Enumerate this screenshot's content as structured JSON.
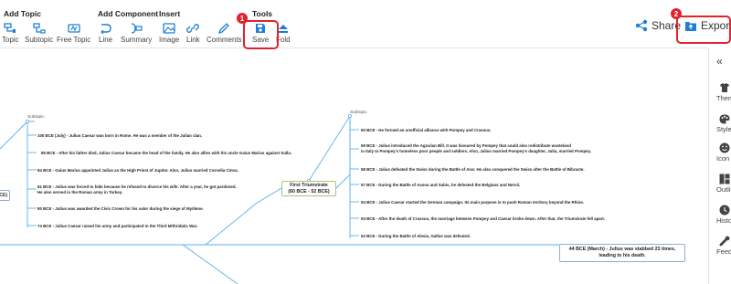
{
  "toolbar": {
    "groups": {
      "add_topic": "Add Topic",
      "add_component": "Add Component",
      "insert": "Insert",
      "tools": "Tools"
    },
    "buttons": {
      "topic": "Topic",
      "subtopic": "Subtopic",
      "free_topic": "Free Topic",
      "line": "Line",
      "summary": "Summary",
      "image": "Image",
      "link": "Link",
      "comments": "Comments",
      "save": "Save",
      "fold": "Fold"
    },
    "share": "Share",
    "export": "Export",
    "badges": {
      "save": "1",
      "export": "2"
    },
    "highlight_color": "#e0232e",
    "icon_color": "#1f7fd6"
  },
  "sidebar": {
    "collapse_icon": "double-chevron-left-icon",
    "items": [
      {
        "label": "Theme",
        "icon": "tshirt-icon"
      },
      {
        "label": "Style",
        "icon": "palette-icon"
      },
      {
        "label": "Icon",
        "icon": "smiley-icon"
      },
      {
        "label": "Outline",
        "icon": "outline-icon"
      },
      {
        "label": "History",
        "icon": "clock-icon"
      },
      {
        "label": "Feedback",
        "icon": "wrench-icon"
      }
    ]
  },
  "mindmap": {
    "line_color": "#5ab0e8",
    "central_topic": {
      "line1": "First Triumvirate",
      "line2": "(60 BCE - 52 BCE)"
    },
    "left_subtopic": {
      "label": "Subtopic",
      "items": [
        "100 BCE (July) - Julius Caesar was born in Rome. He was a member of the Julian clan.",
        "85 BCE - After his father died, Julius Caesar became the head of the family. He also allies with his uncle Gaius Marius against Sulla.",
        "84 BCE - Gaius Marius appointed Julius as the High Priest of Jupiter. Also, Julius married Cornelia Cinna.",
        "81 BCE - Julius was forced to hide because he refused to divorce his wife. After a year, he got pardoned.",
        "He also served in the Roman army in Turkey.",
        "80 BCE - Julius was awarded the Civic Crown for his valor during the siege of Mytilene.",
        "74 BCE - Julius Caesar raised his army and participated in the Third Mithridatic War."
      ]
    },
    "right_subtopic": {
      "label": "Subtopic",
      "items": [
        "60 BCE - He formed an unofficial alliance with Pompey and Crassus.",
        "59 BCE - Julius introduced the Agrarian Bill. It was favoured by Pompey that could also redistribute wasteland",
        "in Italy to Pompey's homeless poor people and soldiers. Also, Julius married Pompey's daughter, Julia, married Pompey.",
        "58 BCE - Julius defeated the Swiss during the Battle of Arar. He also conquered the Swiss after the Battle of Bibracte.",
        "57 BCE - During the Battle of Axona and Sabis, he defeated the Belgians and Nervii.",
        "54 BCE - Julius Caesar started the German campaign. Its main purpose is to push Roman territory beyond the Rhine.",
        "53 BCE - After the death of Crassus, the marriage between Pompey and Caesar broke down. After that, the Triumvirate fell apart.",
        "52 BCE - During the Battle of Alesia, Gallus was defeated."
      ]
    },
    "caesar_topic": {
      "line1": "44 BCE (March) - Julius was stabbed 23 times,",
      "line2": "leading to his death."
    },
    "left_edge_box": "CE)"
  }
}
